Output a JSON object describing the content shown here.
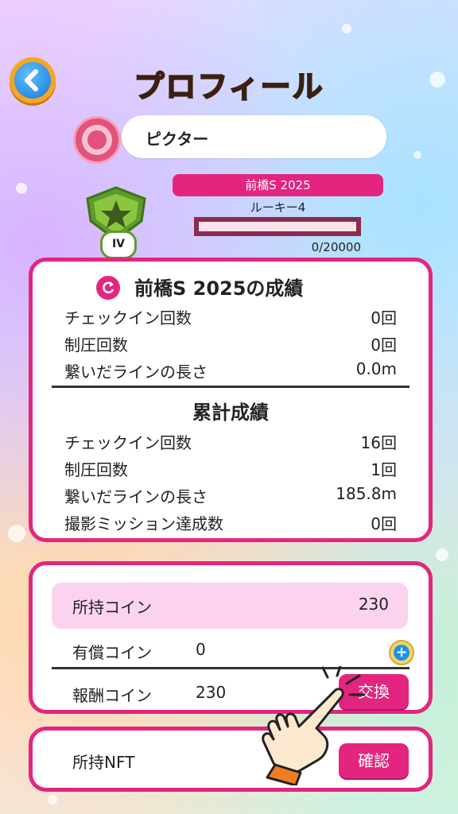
{
  "header": {
    "title": "プロフィール",
    "back_label": "戻る"
  },
  "profile": {
    "name": "ピクター"
  },
  "rank": {
    "season": "前橋S 2025",
    "rank_name": "ルーキー4",
    "badge_numeral": "IV",
    "xp_progress": 0.0,
    "xp_text": "0/20000"
  },
  "season_stats": {
    "title": "前橋S 2025の成績",
    "rows": [
      {
        "label": "チェックイン回数",
        "value": "0回"
      },
      {
        "label": "制圧回数",
        "value": "0回"
      },
      {
        "label": "繋いだラインの長さ",
        "value": "0.0m"
      }
    ]
  },
  "total_stats": {
    "title": "累計成績",
    "rows": [
      {
        "label": "チェックイン回数",
        "value": "16回"
      },
      {
        "label": "制圧回数",
        "value": "1回"
      },
      {
        "label": "繋いだラインの長さ",
        "value": "185.8m"
      },
      {
        "label": "撮影ミッション達成数",
        "value": "0回"
      }
    ]
  },
  "coins": {
    "owned_label": "所持コイン",
    "owned_value": "230",
    "paid_label": "有償コイン",
    "paid_value": "0",
    "reward_label": "報酬コイン",
    "reward_value": "230",
    "exchange_button": "交換"
  },
  "nft": {
    "label": "所持NFT",
    "confirm_button": "確認"
  },
  "colors": {
    "accent": "#e3257f",
    "title": "#3c1f0f",
    "card_bg": "#ffffff",
    "highlight": "#fcd3ef"
  },
  "icons": [
    "back-arrow-icon",
    "avatar-gem-icon",
    "rank-star-shield-icon",
    "refresh-icon",
    "plus-icon",
    "pointing-hand-icon"
  ]
}
